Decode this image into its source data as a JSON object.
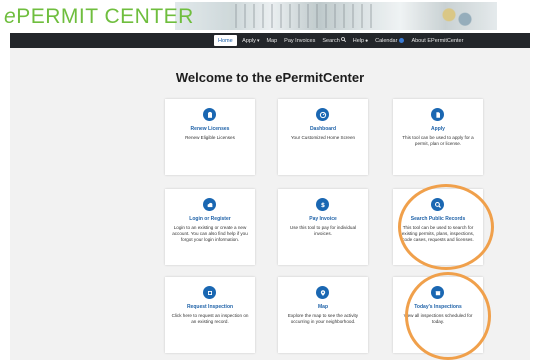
{
  "header": {
    "logo_e": "e",
    "logo_rest": "PERMIT CENTER"
  },
  "nav": {
    "items": [
      {
        "label": "Home",
        "active": true
      },
      {
        "label": "Apply",
        "glyph": "▾"
      },
      {
        "label": "Map"
      },
      {
        "label": "Pay Invoices"
      },
      {
        "label": "Search",
        "glyph": "🔍"
      },
      {
        "label": "Help",
        "glyph": "●"
      },
      {
        "label": "Calendar",
        "badge": true
      },
      {
        "label": "About EPermitCenter"
      }
    ]
  },
  "main": {
    "title": "Welcome to the ePermitCenter",
    "tiles": [
      {
        "icon": "clipboard-icon",
        "title": "Renew Licenses",
        "desc": "Renew Eligible Licenses"
      },
      {
        "icon": "dashboard-icon",
        "title": "Dashboard",
        "desc": "Your Customized Home Screen"
      },
      {
        "icon": "apply-document-icon",
        "title": "Apply",
        "desc": "This tool can be used to apply for a permit, plan or license."
      },
      {
        "icon": "user-cloud-icon",
        "title": "Login or Register",
        "desc": "Login to an existing or create a new account. You can also find help if you forgot your login information."
      },
      {
        "icon": "dollar-icon",
        "title": "Pay Invoice",
        "desc": "Use this tool to pay for individual invoices."
      },
      {
        "icon": "search-icon",
        "title": "Search Public Records",
        "desc": "This tool can be used to search for existing permits, plans, inspections, code cases, requests and licenses."
      },
      {
        "icon": "inspection-icon",
        "title": "Request Inspection",
        "desc": "Click here to request an inspection on an existing record."
      },
      {
        "icon": "map-pin-icon",
        "title": "Map",
        "desc": "Explore the map to see the activity occurring in your neighborhood."
      },
      {
        "icon": "calendar-check-icon",
        "title": "Today's Inspections",
        "desc": "View all inspections scheduled for today."
      }
    ]
  },
  "colors": {
    "logo": "#6fbe3e",
    "navbar": "#23262a",
    "accent": "#1a67b2",
    "highlight": "#f0a04b"
  }
}
